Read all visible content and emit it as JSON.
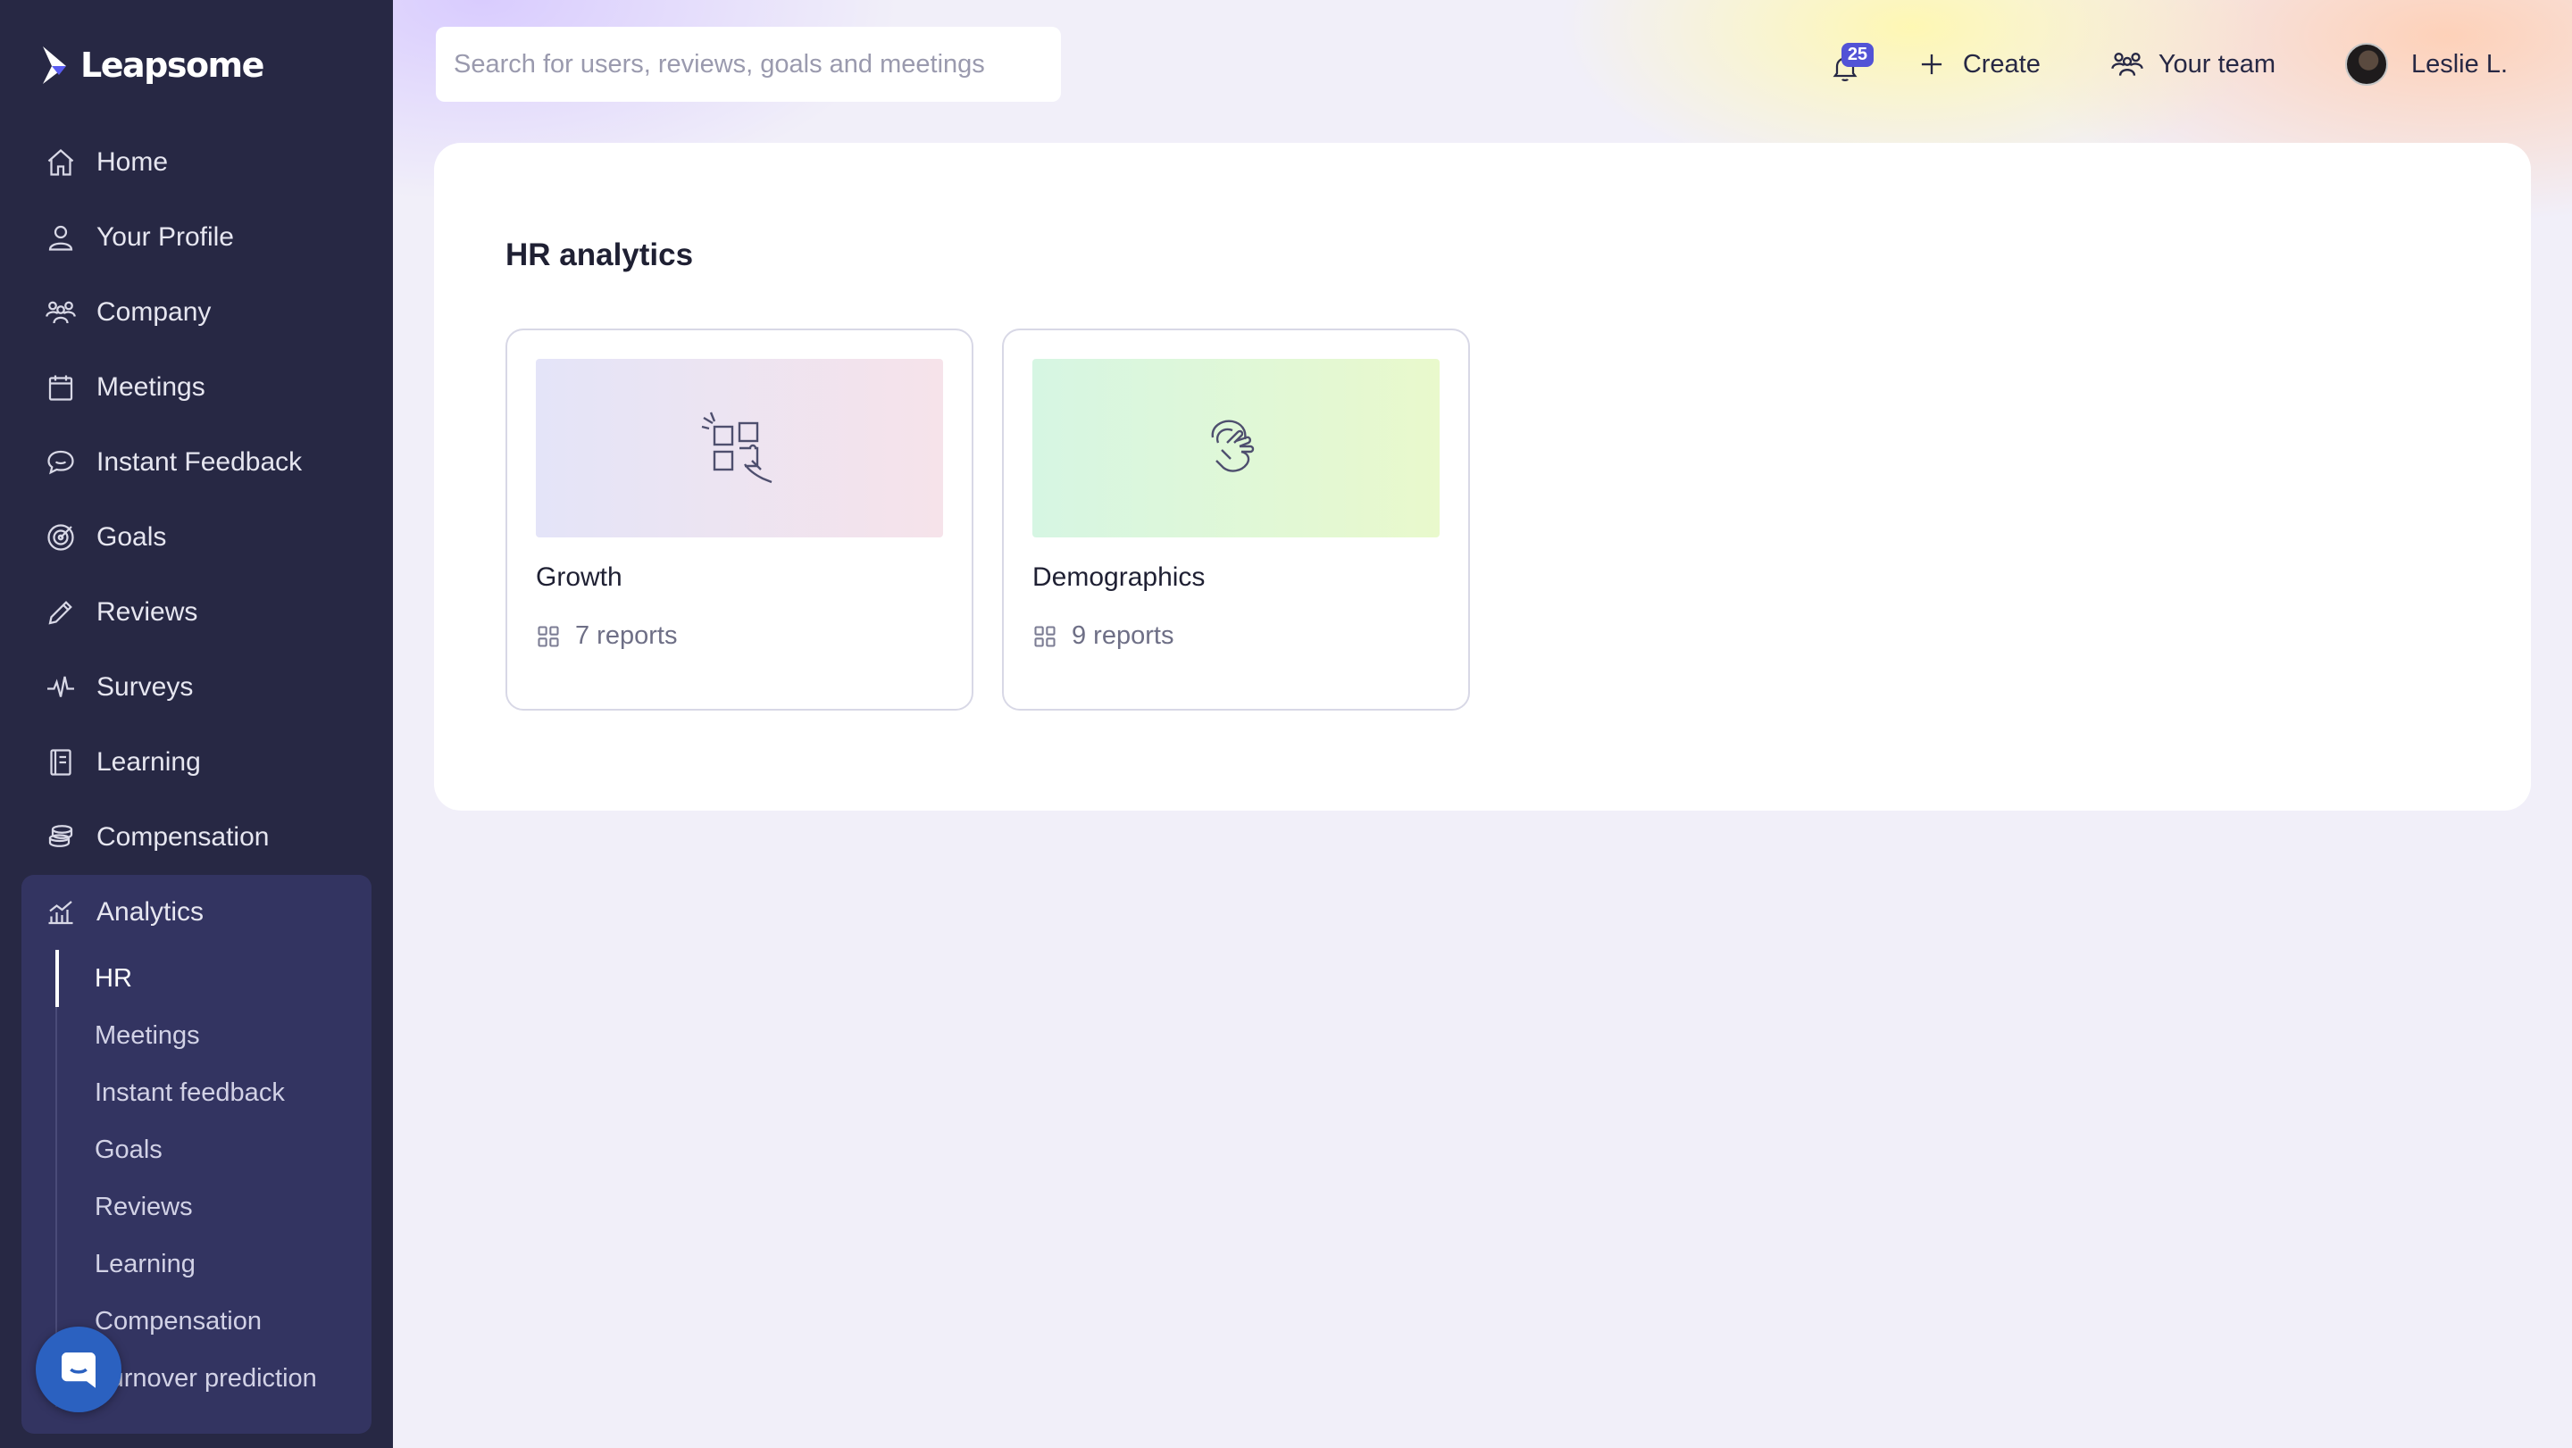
{
  "brand": {
    "name": "Leapsome"
  },
  "sidebar": {
    "items": [
      {
        "label": "Home",
        "icon": "home-icon"
      },
      {
        "label": "Your Profile",
        "icon": "user-icon"
      },
      {
        "label": "Company",
        "icon": "company-icon"
      },
      {
        "label": "Meetings",
        "icon": "calendar-icon"
      },
      {
        "label": "Instant Feedback",
        "icon": "chat-bubble-icon"
      },
      {
        "label": "Goals",
        "icon": "target-icon"
      },
      {
        "label": "Reviews",
        "icon": "pencil-icon"
      },
      {
        "label": "Surveys",
        "icon": "pulse-icon"
      },
      {
        "label": "Learning",
        "icon": "book-icon"
      },
      {
        "label": "Compensation",
        "icon": "coins-icon"
      }
    ],
    "analytics": {
      "label": "Analytics",
      "icon": "analytics-chart-icon",
      "subitems": [
        {
          "label": "HR",
          "active": true
        },
        {
          "label": "Meetings"
        },
        {
          "label": "Instant feedback"
        },
        {
          "label": "Goals"
        },
        {
          "label": "Reviews"
        },
        {
          "label": "Learning"
        },
        {
          "label": "Compensation"
        },
        {
          "label": "Turnover prediction"
        }
      ]
    }
  },
  "header": {
    "search_placeholder": "Search for users, reviews, goals and meetings",
    "notifications_count": "25",
    "create_label": "Create",
    "team_label": "Your team",
    "user_name": "Leslie L."
  },
  "main": {
    "title": "HR analytics",
    "tiles": [
      {
        "name": "Growth",
        "reports": "7 reports",
        "icon": "puzzle-hand-icon"
      },
      {
        "name": "Demographics",
        "reports": "9 reports",
        "icon": "hands-icon"
      }
    ]
  },
  "colors": {
    "sidebar_bg": "#272844",
    "sidebar_group_bg": "#333461",
    "badge": "#5253d6",
    "chat_fab": "#2b61c0"
  }
}
